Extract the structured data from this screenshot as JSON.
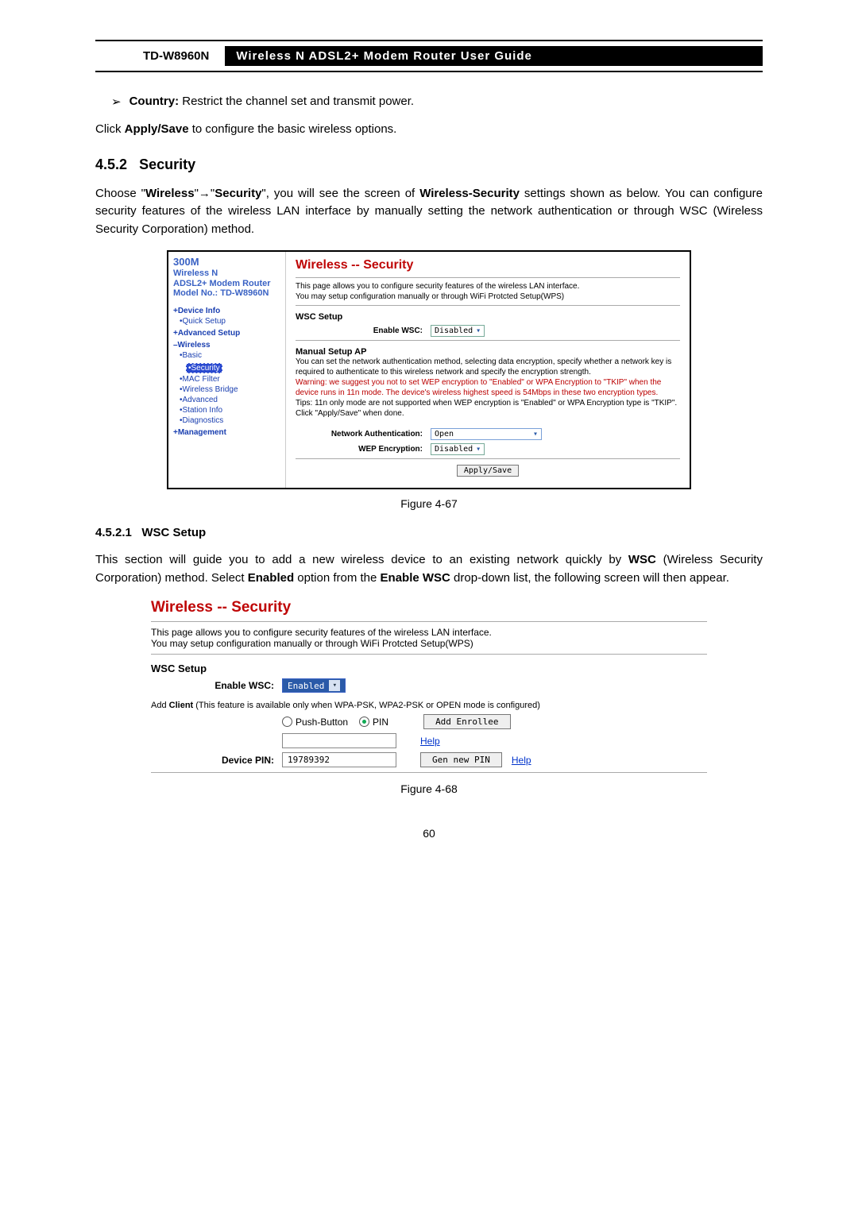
{
  "header": {
    "model": "TD-W8960N",
    "title": "Wireless  N  ADSL2+  Modem  Router  User  Guide"
  },
  "b1": {
    "label": "Country:",
    "text": "Restrict the channel set and transmit power."
  },
  "p1": {
    "pre": "Click ",
    "bold": "Apply/Save",
    "post": " to configure the basic wireless options."
  },
  "sec": {
    "num": "4.5.2",
    "title": "Security"
  },
  "p2a": "Choose \"",
  "p2b": "Wireless",
  "p2c": "\"→\"",
  "p2d": "Security",
  "p2e": "\", you will see the screen of ",
  "p2f": "Wireless-Security",
  "p2g": " settings shown as below. You can configure security features of the wireless LAN interface by manually setting the network authentication or through WSC (Wireless Security Corporation) method.",
  "shot1": {
    "side": {
      "brand1": "300M",
      "brand2": "Wireless N",
      "brand3": "ADSL2+ Modem Router",
      "brand4": "Model No.: TD-W8960N",
      "items": [
        "+Device Info",
        "•Quick Setup",
        "+Advanced Setup",
        "–Wireless",
        "•Basic",
        "•Security",
        "•MAC Filter",
        "•Wireless Bridge",
        "•Advanced",
        "•Station Info",
        "•Diagnostics",
        "+Management"
      ]
    },
    "title": "Wireless -- Security",
    "desc1": "This page allows you to configure security features of the wireless LAN interface.",
    "desc2": "You may setup configuration manually or through WiFi Protcted Setup(WPS)",
    "wsc_h": "WSC Setup",
    "enable_label": "Enable WSC:",
    "enable_val": "Disabled",
    "man_h": "Manual Setup AP",
    "man_p1": "You can set the network authentication method, selecting data encryption, specify whether a network key is required to authenticate to this wireless network and specify the encryption strength.",
    "man_warn": "Warning: we suggest you not to set WEP encryption to \"Enabled\" or WPA Encryption to \"TKIP\" when the device runs in 11n mode. The device's wireless highest speed is 54Mbps in these two encryption types.",
    "man_tip": "Tips: 11n only mode are not supported when WEP encryption is \"Enabled\" or WPA Encryption type is \"TKIP\".",
    "man_click": "Click \"Apply/Save\" when done.",
    "na_label": "Network Authentication:",
    "na_val": "Open",
    "wep_label": "WEP Encryption:",
    "wep_val": "Disabled",
    "apply": "Apply/Save"
  },
  "fig1": "Figure 4-67",
  "sub": {
    "num": "4.5.2.1",
    "title": "WSC Setup"
  },
  "p3a": "This section will guide you to add a new wireless device to an existing network quickly by ",
  "p3b": "WSC",
  "p3c": " (Wireless Security Corporation) method. Select ",
  "p3d": "Enabled",
  "p3e": " option from the ",
  "p3f": "Enable WSC",
  "p3g": " drop-down list, the following screen will then appear.",
  "shot2": {
    "title": "Wireless -- Security",
    "desc1": "This page allows you to configure security features of the wireless LAN interface.",
    "desc2": "You may setup configuration manually or through WiFi Protcted Setup(WPS)",
    "wsc_h": "WSC Setup",
    "enable_label": "Enable WSC:",
    "enable_val": "Enabled",
    "addc_pre": "Add ",
    "addc_b": "Client",
    "addc_post": " (This feature is available only when WPA-PSK, WPA2-PSK or OPEN mode is configured)",
    "r1": "Push-Button",
    "r2": "PIN",
    "add_btn": "Add Enrollee",
    "help": "Help",
    "pin_label": "Device PIN:",
    "pin_val": "19789392",
    "gen_btn": "Gen new PIN"
  },
  "fig2": "Figure 4-68",
  "pageno": "60"
}
